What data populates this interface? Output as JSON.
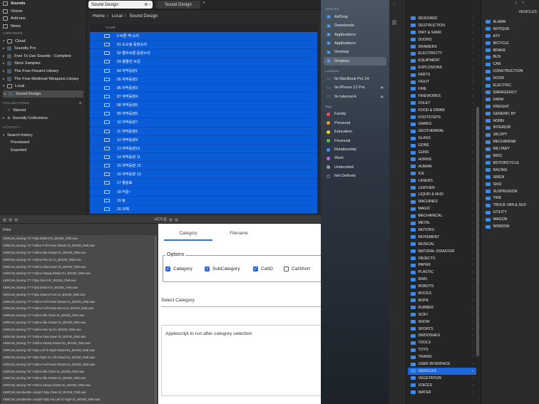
{
  "soundly": {
    "sidebar": {
      "top_items": [
        {
          "label": "Sounds",
          "icon": "waveform-icon",
          "bold": true
        },
        {
          "label": "Voices",
          "icon": "speech-bubble-icon"
        },
        {
          "label": "Add-ons",
          "icon": "puzzle-icon"
        },
        {
          "label": "News",
          "icon": "news-icon"
        }
      ],
      "libraries_heading": "LIBRARIES",
      "libraries": [
        {
          "label": "Cloud",
          "arrow": "▾",
          "icon": "cloud-icon"
        },
        {
          "label": "Soundly Pro",
          "arrow": "▸",
          "indent": true
        },
        {
          "label": "Free To Use Sounds - Complete",
          "arrow": "▸",
          "indent": true
        },
        {
          "label": "Store Samples",
          "arrow": "▸",
          "indent": true
        },
        {
          "label": "The Free Firearm Library",
          "arrow": "▸",
          "indent": true
        },
        {
          "label": "The Free Medieval Weapons Library",
          "arrow": "▸",
          "indent": true
        },
        {
          "label": "Local",
          "arrow": "▾",
          "icon": "local-icon"
        },
        {
          "label": "Sound Design",
          "arrow": "▸",
          "indent": true,
          "selected": true
        }
      ],
      "collections_heading": "COLLECTIONS",
      "collections": [
        {
          "label": "Starred",
          "icon": "star-icon"
        },
        {
          "label": "Soundly Collections",
          "arrow": "▸",
          "icon": "globe-icon"
        }
      ],
      "activity_heading": "ACTIVITY",
      "activity": [
        {
          "label": "Search history",
          "arrow": "▾"
        },
        {
          "label": "Previewed"
        },
        {
          "label": "Exported"
        }
      ]
    },
    "search": {
      "value": "Sound Design:"
    },
    "tab_label": "Sound Design",
    "tab_plus": "+",
    "breadcrumb": [
      "Home",
      "Local",
      "Sound Design"
    ],
    "column_header": "NAME",
    "files": [
      "0 버튼 찍 소리",
      "01 도오링 등장소리",
      "02 뿅르르룽 등장소리",
      "03 올뿅한 브금",
      "04 자막등장1",
      "05 자막등장2",
      "06 자막등장3",
      "07 자막등장4",
      "08 자막등장5",
      "09 자막등장6",
      "10 자막등장7",
      "11 자막등장8",
      "12 자막등장9",
      "13 자막등장10",
      "14 자막등장 11",
      "15 자막등장 12",
      "16 자막등장 13",
      "17 물음표",
      "18 커윤~",
      "19 늉",
      "20 모헤"
    ]
  },
  "ucs": {
    "title": "UCS R",
    "files_label": "Files",
    "files": [
      "AERO­Jet_Boeing 747 Flyby Distant 01_BOOM_ONE.wav",
      "AERO­Jet_Boeing 747 Turbine Full Power Distant 01_BOOM_ONE.wav",
      "AERO­Jet_Boeing 747 Turbine Idle Distant 01_BOOM_ONE.wav",
      "AERO­Jet_Boeing 747 Turbine Rev Up 01_BOOM_ONE.wav",
      "AERO­Jet_Boeing 747 Turbine Slow Down 01_BOOM_ONE.wav",
      "AERO­Jet_Boeing 747 Turbine Steady Distant 01_BOOM_ONE.wav",
      "AERO­Jet_Boeing 777 Flyby Direct 01_BOOM_ONE.wav",
      "AERO­Jet_Boeing 777 Flyby Distant 01_BOOM_ONE.wav",
      "AERO­Jet_Boeing 777 Flyby Distant Front 01_BOOM_ONE.wav",
      "AERO­Jet_Boeing 777 Turbine Full Power Distant 01_BOOM_ONE.wav",
      "AERO­Jet_Boeing 777 Turbine Full Power Direct 01_BOOM_ONE.wav",
      "AERO­Jet_Boeing 777 Turbine Idle Close 01_BOOM_ONE.wav",
      "AERO­Jet_Boeing 777 Turbine Idle Distant 01_BOOM_ONE.wav",
      "AERO­Jet_Boeing 777 Turbine Rev Up 01_BOOM_ONE.wav",
      "AERO­Jet_Boeing 777 Turbine Slow Down 01_BOOM_ONE.wav",
      "AERO­Jet_Boeing 777 Turbine Steady Distant 01_BOOM_ONE.wav",
      "AERO­Jet_Boeing 787 Flyby Left To Right Distant 01_BOOM_ONE.wav",
      "AERO­Jet_Boeing 787 Flyby Right To Left Distant 01_BOOM_ONE.wav",
      "AERO­Jet_Boeing 787 Turbine Full Power Distant 01_BOOM_ONE.wav",
      "AERO­Jet_Boeing 787 Turbine Idle Close 01_BOOM_ONE.wav",
      "AERO­Jet_Boeing 787 Turbine Idle Distant 01_BOOM_ONE.wav",
      "AERO­Jet_Boeing 787 Turbine Steady Distant 01_BOOM_ONE.wav",
      "AERO­Jet_Bombardier Learjet Flyby Close 01_BOOM_ONE.wav",
      "AERO­Jet_Bombardier Learjet Flyby Far Left To Right 01_BOOM_ONE.wav"
    ],
    "tabs": {
      "category": "Category",
      "filename": "Filename"
    },
    "options_label": "Options",
    "options": [
      {
        "label": "Category",
        "checked": true
      },
      {
        "label": "SubCategory",
        "checked": true
      },
      {
        "label": "CatID",
        "checked": true
      },
      {
        "label": "CatShort",
        "checked": false
      }
    ],
    "select_category": "Select Category",
    "applescript_label": "Applescript to run after category selection",
    "accent_color": "#2f66d1"
  },
  "finder": {
    "favorites_heading": "Favorites",
    "favorites": [
      {
        "label": "AirDrop",
        "icon": "airdrop-icon"
      },
      {
        "label": "Downloads",
        "icon": "downloads-icon"
      },
      {
        "label": "Applications",
        "icon": "applications-icon"
      },
      {
        "label": "Applications",
        "icon": "applications-icon"
      },
      {
        "label": "Desktop",
        "icon": "desktop-icon"
      },
      {
        "label": "Dropbox",
        "icon": "dropbox-icon",
        "selected": true
      }
    ],
    "locations_heading": "Locations",
    "locations": [
      {
        "label": "Ils MacBook Pro 14",
        "icon": "laptop-icon"
      },
      {
        "label": "Ils iPhone 12 Pro",
        "icon": "phone-icon",
        "eject": true
      },
      {
        "label": "Ils Internal A",
        "icon": "drive-icon",
        "eject": true
      }
    ],
    "tags_heading": "Tags",
    "tags": [
      {
        "label": "Family",
        "color": "#e8505b"
      },
      {
        "label": "Personal",
        "color": "#f09a37"
      },
      {
        "label": "Education",
        "color": "#f4d03f"
      },
      {
        "label": "Financial",
        "color": "#5bbf5b"
      },
      {
        "label": "Relationship",
        "color": "#3f8ff0"
      },
      {
        "label": "Work",
        "color": "#b06fe0"
      },
      {
        "label": "Undecided",
        "color": "#9a9a9a"
      },
      {
        "label": "Not Defined",
        "color": "#2c2c2c"
      }
    ],
    "categories": [
      "DESIGNED",
      "DESTRUCTION",
      "DIRT & SAND",
      "DOORS",
      "DRAWERS",
      "ELECTRICITY",
      "EQUIPMENT",
      "EXPLOSIONS",
      "FARTS",
      "FIGHT",
      "FIRE",
      "FIREWORKS",
      "FOLEY",
      "FOOD & DRINK",
      "FOOTSTEPS",
      "GAMES",
      "GEOTHERMAL",
      "GLASS",
      "GORE",
      "GUNS",
      "HORNS",
      "HUMAN",
      "ICE",
      "LASERS",
      "LEATHER",
      "LIQUID & MUD",
      "MACHINES",
      "MAGIC",
      "MECHANICAL",
      "METAL",
      "MOTORS",
      "MOVEMENT",
      "MUSICAL",
      "NATURAL DISASTER",
      "OBJECTS",
      "PAPER",
      "PLASTIC",
      "RAIN",
      "ROBOTS",
      "ROCKS",
      "ROPE",
      "RUBBER",
      "SCIFI",
      "SNOW",
      "SPORTS",
      "SWOOSHES",
      "TOOLS",
      "TOYS",
      "TRAINS",
      "USER INTERFACE",
      "VEHICLES",
      "VEGETATION",
      "VOICES",
      "WATER"
    ],
    "selected_category": "VEHICLES",
    "vehicles_title": "VEHICLES",
    "vehicles": [
      "ALARM",
      "ANTIQUE",
      "ATV",
      "BICYCLE",
      "BRAKE",
      "BUS",
      "CAR",
      "CONSTRUCTION",
      "DOOR",
      "ELECTRIC",
      "EMERGENCY",
      "FARM",
      "FREIGHT",
      "GENERIC BY",
      "HORN",
      "INTERIOR",
      "JALOPY",
      "MECHANISM",
      "MILITARY",
      "MISC",
      "MOTORCYCLE",
      "RACING",
      "SIREN",
      "SKID",
      "SUSPENSION",
      "TIRE",
      "TRUCK VAN & SUV",
      "UTILITY",
      "WAGON",
      "WINDOW"
    ]
  }
}
